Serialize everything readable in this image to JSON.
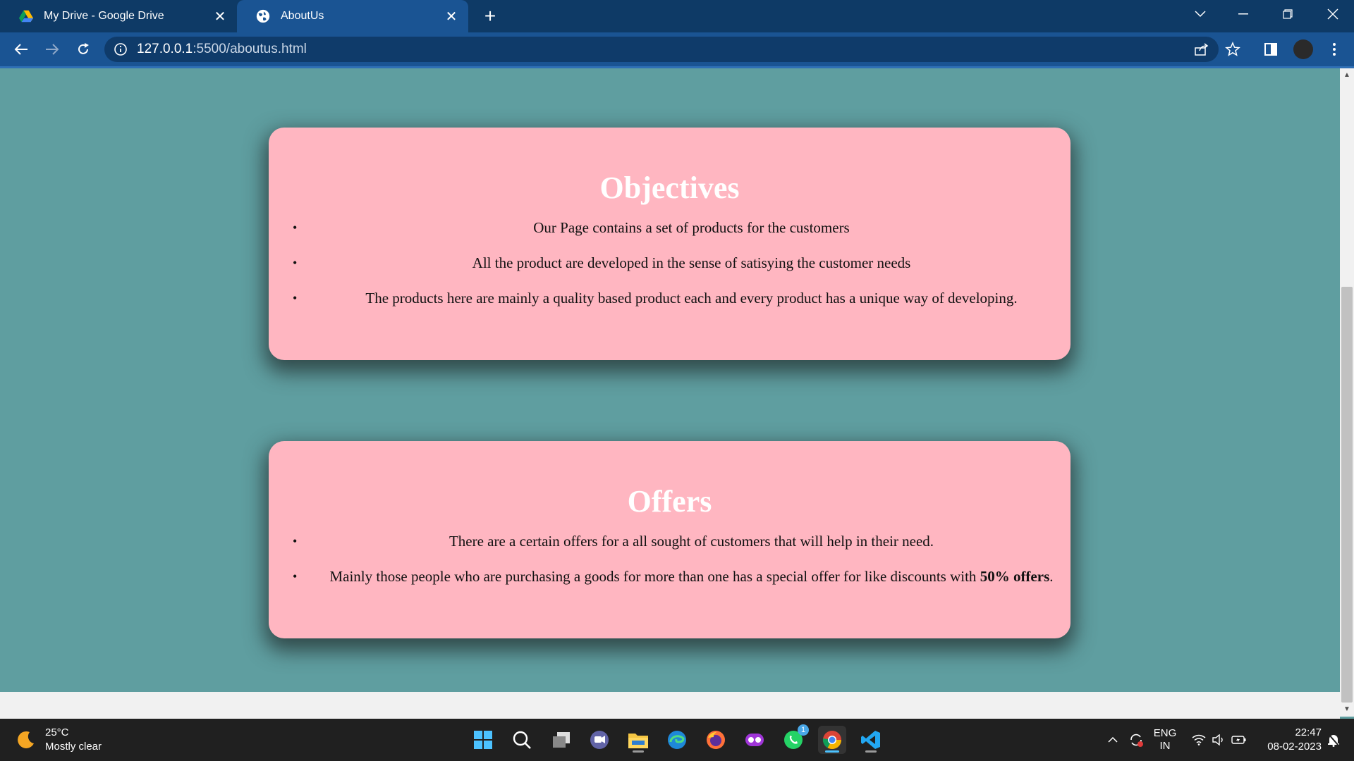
{
  "browser": {
    "tabs": [
      {
        "title": "My Drive - Google Drive",
        "icon": "google-drive-icon",
        "active": false
      },
      {
        "title": "AboutUs",
        "icon": "globe-icon",
        "active": true
      }
    ],
    "new_tab_icon": "plus-icon",
    "url_host": "127.0.0.1",
    "url_path": ":5500/aboutus.html",
    "accent_color": "#0e3a66",
    "toolbar_color": "#1a5493"
  },
  "page": {
    "background": "#5f9ea0",
    "card_color": "#ffb6c1",
    "objectives": {
      "heading": "Objectives",
      "items": [
        "Our Page contains a set of products for the customers",
        "All the product are developed in the sense of satisying the customer needs",
        "The products here are mainly a quality based product each and every product has a unique way of developing."
      ]
    },
    "offers": {
      "heading": "Offers",
      "items": [
        "There are a certain offers for a all sought of customers that will help in their need.",
        "Mainly those people who are purchasing a goods for more than one has a special offer for like discounts with "
      ],
      "bold_text": "50% offers",
      "trailing_text": "."
    }
  },
  "taskbar": {
    "weather_temp": "25°C",
    "weather_desc": "Mostly clear",
    "whatsapp_badge": "1",
    "language_top": "ENG",
    "language_bottom": "IN",
    "time": "22:47",
    "date": "08-02-2023"
  }
}
